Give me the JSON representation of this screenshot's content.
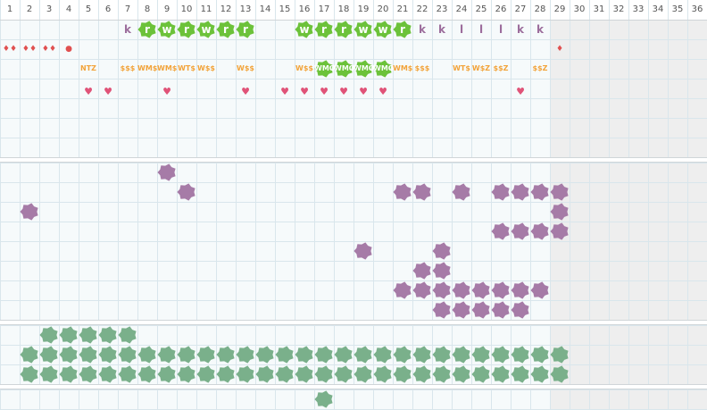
{
  "header": {
    "days": [
      "1",
      "2",
      "3",
      "4",
      "5",
      "6",
      "7",
      "8",
      "9",
      "10",
      "11",
      "12",
      "13",
      "14",
      "15",
      "16",
      "17",
      "18",
      "19",
      "20",
      "21",
      "22",
      "23",
      "24",
      "25",
      "26",
      "27",
      "28",
      "29",
      "30",
      "31",
      "32",
      "33",
      "34",
      "35",
      "36"
    ],
    "active_days": 28
  },
  "colors": {
    "grid_line": "#d9e6ec",
    "cell_bg": "#f6fafb",
    "inactive_bg": "#eeeeee",
    "separator": "#d0d5d8",
    "green": "#6cc23a",
    "purple": "#a67ba7",
    "teal": "#7ab08b",
    "pink": "#e05378",
    "red": "#e05050",
    "orange": "#f2a33a",
    "letter_purple": "#9c6d9c"
  },
  "markers": {
    "letters_row": {
      "items": [
        {
          "day": 7,
          "text": "k",
          "style": "plain"
        },
        {
          "day": 8,
          "text": "r",
          "style": "green"
        },
        {
          "day": 9,
          "text": "w",
          "style": "green"
        },
        {
          "day": 10,
          "text": "r",
          "style": "green"
        },
        {
          "day": 11,
          "text": "w",
          "style": "green"
        },
        {
          "day": 12,
          "text": "r",
          "style": "green"
        },
        {
          "day": 13,
          "text": "r",
          "style": "green"
        },
        {
          "day": 16,
          "text": "w",
          "style": "green"
        },
        {
          "day": 17,
          "text": "r",
          "style": "green"
        },
        {
          "day": 18,
          "text": "r",
          "style": "green"
        },
        {
          "day": 19,
          "text": "w",
          "style": "green"
        },
        {
          "day": 20,
          "text": "w",
          "style": "green"
        },
        {
          "day": 21,
          "text": "r",
          "style": "green"
        },
        {
          "day": 22,
          "text": "k",
          "style": "plain"
        },
        {
          "day": 23,
          "text": "k",
          "style": "plain"
        },
        {
          "day": 24,
          "text": "l",
          "style": "plain"
        },
        {
          "day": 25,
          "text": "l",
          "style": "plain"
        },
        {
          "day": 26,
          "text": "l",
          "style": "plain"
        },
        {
          "day": 27,
          "text": "k",
          "style": "plain"
        },
        {
          "day": 28,
          "text": "k",
          "style": "plain"
        }
      ]
    },
    "drops_row": {
      "items": [
        {
          "day": 1,
          "symbol": "♦♦"
        },
        {
          "day": 2,
          "symbol": "♦♦"
        },
        {
          "day": 3,
          "symbol": "♦♦"
        },
        {
          "day": 4,
          "symbol": "●"
        },
        {
          "day": 29,
          "symbol": "♦"
        }
      ]
    },
    "codes_row": {
      "items": [
        {
          "day": 5,
          "text": "NTZ",
          "style": "plain"
        },
        {
          "day": 7,
          "text": "$$$",
          "style": "plain"
        },
        {
          "day": 8,
          "text": "WM$",
          "style": "plain"
        },
        {
          "day": 9,
          "text": "WM$",
          "style": "plain"
        },
        {
          "day": 10,
          "text": "WT$",
          "style": "plain"
        },
        {
          "day": 11,
          "text": "W$$",
          "style": "plain"
        },
        {
          "day": 13,
          "text": "W$$",
          "style": "plain"
        },
        {
          "day": 16,
          "text": "W$$",
          "style": "plain"
        },
        {
          "day": 17,
          "text": "WMO",
          "style": "green"
        },
        {
          "day": 18,
          "text": "WMO",
          "style": "green"
        },
        {
          "day": 19,
          "text": "WMO",
          "style": "green"
        },
        {
          "day": 20,
          "text": "WMO",
          "style": "green"
        },
        {
          "day": 21,
          "text": "WM$",
          "style": "plain"
        },
        {
          "day": 22,
          "text": "$$$",
          "style": "plain"
        },
        {
          "day": 24,
          "text": "WT$",
          "style": "plain"
        },
        {
          "day": 25,
          "text": "W$Z",
          "style": "plain"
        },
        {
          "day": 26,
          "text": "$$Z",
          "style": "plain"
        },
        {
          "day": 28,
          "text": "$$Z",
          "style": "plain"
        }
      ]
    },
    "hearts_row": {
      "items": [
        {
          "day": 5,
          "symbol": "♥"
        },
        {
          "day": 6,
          "symbol": "♥"
        },
        {
          "day": 9,
          "symbol": "♥"
        },
        {
          "day": 13,
          "symbol": "♥"
        },
        {
          "day": 15,
          "symbol": "♥"
        },
        {
          "day": 16,
          "symbol": "♥"
        },
        {
          "day": 17,
          "symbol": "♥"
        },
        {
          "day": 18,
          "symbol": "♥"
        },
        {
          "day": 19,
          "symbol": "♥"
        },
        {
          "day": 20,
          "symbol": "♥"
        },
        {
          "day": 27,
          "symbol": "♥"
        }
      ]
    }
  },
  "blocks": {
    "purple": [
      {
        "day": 9,
        "row": 0
      },
      {
        "day": 10,
        "row": 1
      },
      {
        "day": 21,
        "row": 1
      },
      {
        "day": 22,
        "row": 1
      },
      {
        "day": 24,
        "row": 1
      },
      {
        "day": 26,
        "row": 1
      },
      {
        "day": 27,
        "row": 1
      },
      {
        "day": 28,
        "row": 1
      },
      {
        "day": 29,
        "row": 1
      },
      {
        "day": 2,
        "row": 2
      },
      {
        "day": 29,
        "row": 2
      },
      {
        "day": 26,
        "row": 3
      },
      {
        "day": 27,
        "row": 3
      },
      {
        "day": 28,
        "row": 3
      },
      {
        "day": 29,
        "row": 3
      },
      {
        "day": 19,
        "row": 4
      },
      {
        "day": 23,
        "row": 4
      },
      {
        "day": 22,
        "row": 5
      },
      {
        "day": 23,
        "row": 5
      },
      {
        "day": 21,
        "row": 6
      },
      {
        "day": 22,
        "row": 6
      },
      {
        "day": 23,
        "row": 6
      },
      {
        "day": 24,
        "row": 6
      },
      {
        "day": 25,
        "row": 6
      },
      {
        "day": 26,
        "row": 6
      },
      {
        "day": 27,
        "row": 6
      },
      {
        "day": 28,
        "row": 6
      },
      {
        "day": 23,
        "row": 7
      },
      {
        "day": 24,
        "row": 7
      },
      {
        "day": 25,
        "row": 7
      },
      {
        "day": 26,
        "row": 7
      },
      {
        "day": 27,
        "row": 7
      }
    ],
    "teal_row0_days": [
      3,
      4,
      5,
      6,
      7
    ],
    "teal_row1_from": 2,
    "teal_row1_to": 29,
    "teal_row2_from": 2,
    "teal_row2_to": 29,
    "teal_bottom": [
      17
    ]
  }
}
